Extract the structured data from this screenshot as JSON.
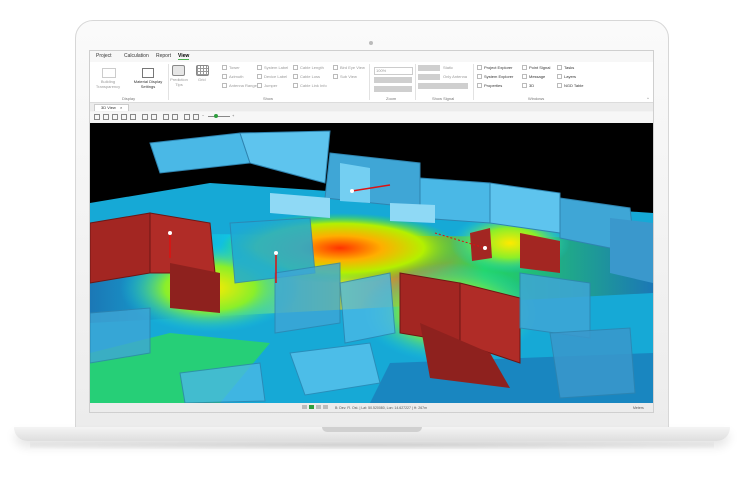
{
  "ribbon": {
    "tabs": [
      "Project",
      "Calculation",
      "Report",
      "View"
    ],
    "active_tab": "View",
    "display_group": {
      "label": "Display",
      "building_transparency": "Building Transparency",
      "material_display": "Material Display Settings"
    },
    "show_group": {
      "label": "Show",
      "prediction_tips": "Prediction Tips",
      "grid": "Grid",
      "col1": [
        "Tower",
        "Azimuth",
        "Antenna Range"
      ],
      "col2": [
        "System Label",
        "Device Label",
        "Jumper"
      ],
      "col3": [
        "Cable Length",
        "Cable Loss",
        "Cable Link Info"
      ],
      "col4": [
        "Bird Eye View",
        "Sub View"
      ]
    },
    "zoom_group": {
      "label": "Zoom",
      "value": "100%"
    },
    "show_signal_group": {
      "label": "Show Signal",
      "items": [
        "Static",
        "Only Antenna"
      ]
    },
    "windows_group": {
      "label": "Windows",
      "col1": [
        "Project Explorer",
        "System Explorer",
        "Properties"
      ],
      "col2": [
        "Point Signal",
        "Message",
        "3D"
      ],
      "col3": [
        "Tasks",
        "Layers",
        "NGD Table"
      ]
    }
  },
  "document_tab": "3D View",
  "statusbar": {
    "coords": "B: Dev. Fl. Ost. | Lat: 50.520080, Lon: 14.627227 | H: 267m",
    "units": "Meters"
  },
  "colors": {
    "accent_green": "#2e9e3e",
    "wall_blue": "#4ab8e6",
    "wall_red": "#a32622",
    "heat_red": "#ff3300",
    "heat_yellow": "#ffea00",
    "heat_green": "#26e04a",
    "heat_cyan": "#10c9e6",
    "floor_blue": "#1c6fb0"
  }
}
